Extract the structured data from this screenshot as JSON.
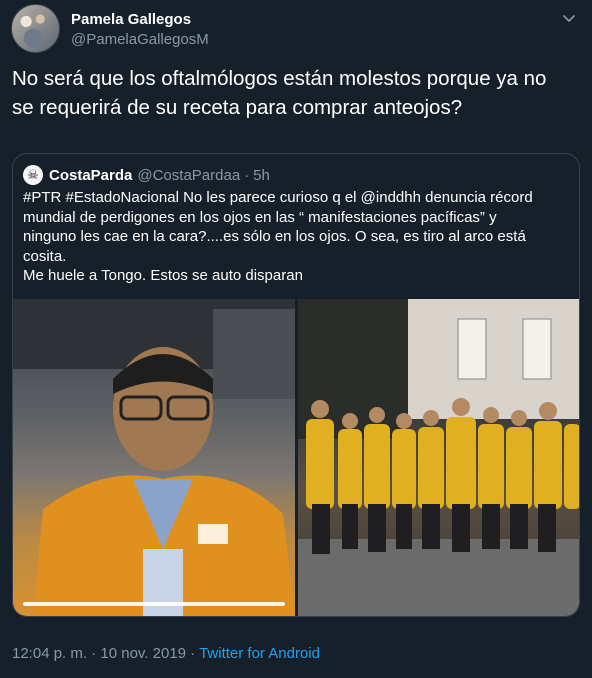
{
  "tweet": {
    "author_name": "Pamela Gallegos",
    "author_handle": "@PamelaGallegosM",
    "text": "No será que los oftalmólogos están molestos porque ya no se requerirá de su receta para comprar anteojos?",
    "timestamp": "12:04 p. m. · 10 nov. 2019",
    "separator": " · ",
    "source": "Twitter for Android"
  },
  "quoted": {
    "author_name": "CostaParda",
    "author_handle": "@CostaPardaa",
    "dot": "·",
    "time": "5h",
    "text_lines": [
      "#PTR #EstadoNacional No les parece curioso q el @inddhh denuncia récord",
      "mundial de perdigones en los ojos en las “ manifestaciones pacíficas” y",
      "ninguno les cae en la cara?....es sólo en los ojos. O sea, es tiro al arco está",
      "cosita.",
      "Me huele a Tongo. Estos se auto disparan"
    ]
  },
  "icons": {
    "caret": "chevron-down-icon",
    "quoted_avatar": "skull-icon"
  },
  "colors": {
    "background": "#15202b",
    "border": "#38444d",
    "secondary_text": "#8899a6",
    "link": "#1da1f2"
  }
}
